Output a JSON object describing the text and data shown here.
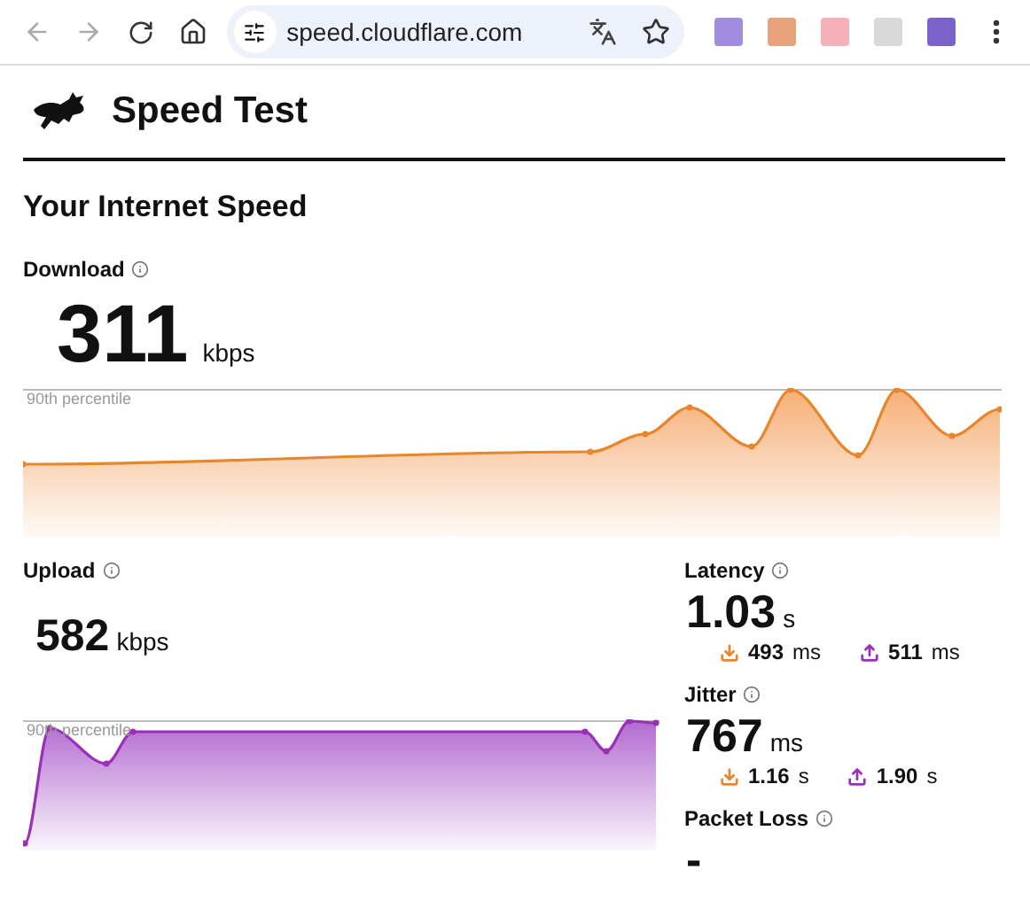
{
  "browser": {
    "url": "speed.cloudflare.com",
    "extensions": [
      {
        "color": "#a08de0"
      },
      {
        "color": "#e8a27c"
      },
      {
        "color": "#f5b0b8"
      },
      {
        "color": "#d9d9d9"
      },
      {
        "color": "#7a62c8"
      }
    ]
  },
  "header": {
    "title": "Speed Test"
  },
  "section_title": "Your Internet Speed",
  "download": {
    "label": "Download",
    "value": "311",
    "unit": "kbps",
    "chart_label": "90th percentile"
  },
  "upload": {
    "label": "Upload",
    "value": "582",
    "unit": "kbps",
    "chart_label": "90th percentile"
  },
  "latency": {
    "label": "Latency",
    "value": "1.03",
    "unit": "s",
    "down": {
      "value": "493",
      "unit": "ms"
    },
    "up": {
      "value": "511",
      "unit": "ms"
    }
  },
  "jitter": {
    "label": "Jitter",
    "value": "767",
    "unit": "ms",
    "down": {
      "value": "1.16",
      "unit": "s"
    },
    "up": {
      "value": "1.90",
      "unit": "s"
    }
  },
  "packet_loss": {
    "label": "Packet Loss",
    "value": "-"
  }
}
